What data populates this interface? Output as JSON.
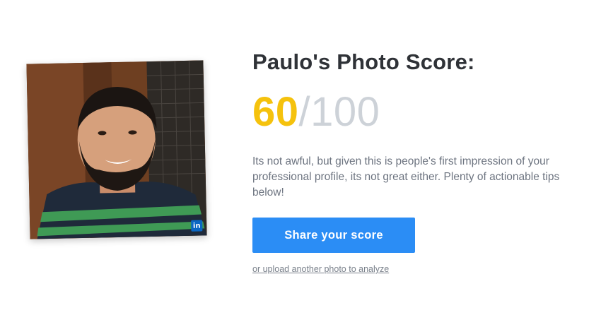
{
  "header": {
    "title": "Paulo's Photo Score:"
  },
  "score": {
    "value": "60",
    "separator": "/",
    "max": "100"
  },
  "description": "Its not awful, but given this is people's first impression of your professional profile, its not great either. Plenty of actionable tips below!",
  "actions": {
    "share_label": "Share your score",
    "upload_link_label": "or upload another photo to analyze"
  },
  "photo": {
    "badge_text": "in",
    "badge_icon": "linkedin-icon"
  },
  "colors": {
    "score_accent": "#f5c20d",
    "score_muted": "#cdd2d8",
    "button": "#2b8df5",
    "linkedin": "#0a66c2"
  }
}
